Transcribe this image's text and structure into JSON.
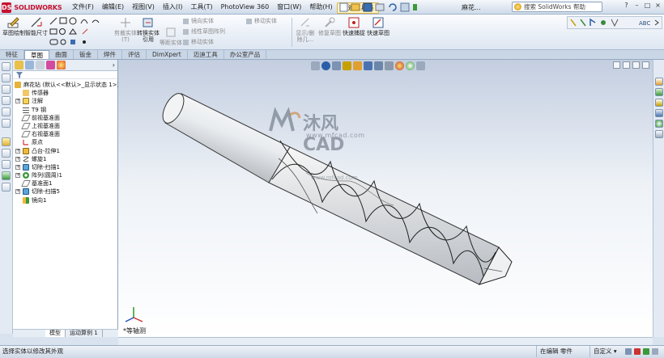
{
  "app": {
    "brand": "SOLIDWORKS",
    "logo_mark": "DS"
  },
  "menu": [
    "文件(F)",
    "编辑(E)",
    "视图(V)",
    "插入(I)",
    "工具(T)",
    "PhotoView 360",
    "窗口(W)",
    "帮助(H)",
    "迈迪工具集"
  ],
  "quickbar": {
    "doc_name": "麻花..."
  },
  "search": {
    "placeholder": "搜索 SolidWorks 帮助"
  },
  "window_buttons": [
    "?",
    "–",
    "□",
    "×"
  ],
  "commands": {
    "sketch": "草图绘制",
    "smart_dim": "智能尺寸",
    "trim": "剪裁实体(T)",
    "convert": "转换实体引用",
    "offset": "等距实体",
    "mirror": "镜向实体",
    "linear_pattern": "线性草图阵列",
    "move": "移动实体",
    "display_delete": "显示/删除几...",
    "repair": "修复草图",
    "rapid_sketch": "快速捕捉",
    "quick_sketch": "快速草图"
  },
  "tabs": [
    "特征",
    "草图",
    "曲面",
    "钣金",
    "焊件",
    "评估",
    "DimXpert",
    "迈迪工具",
    "办公室产品"
  ],
  "active_tab": "草图",
  "tree": {
    "root": "麻花钻  (默认<<默认>_显示状态 1>)",
    "items": [
      {
        "label": "传感器",
        "icon": "sensor-icon",
        "exp": ""
      },
      {
        "label": "注解",
        "icon": "annotation-icon",
        "exp": "+"
      },
      {
        "label": "T9  钢",
        "icon": "material-icon",
        "exp": ""
      },
      {
        "label": "前视基准面",
        "icon": "plane-icon",
        "exp": ""
      },
      {
        "label": "上视基准面",
        "icon": "plane-icon",
        "exp": ""
      },
      {
        "label": "右视基准面",
        "icon": "plane-icon",
        "exp": ""
      },
      {
        "label": "原点",
        "icon": "origin-icon",
        "exp": ""
      },
      {
        "label": "凸台-拉伸1",
        "icon": "extrude-icon",
        "exp": "+"
      },
      {
        "label": "螺旋1",
        "icon": "helix-icon",
        "exp": "+"
      },
      {
        "label": "切除-扫描1",
        "icon": "sweep-cut-icon",
        "exp": "+"
      },
      {
        "label": "阵列(圆周)1",
        "icon": "pattern-icon",
        "exp": "+"
      },
      {
        "label": "基准面1",
        "icon": "plane-icon",
        "exp": ""
      },
      {
        "label": "切除-扫描5",
        "icon": "sweep-cut-icon",
        "exp": "+"
      },
      {
        "label": "镜向1",
        "icon": "mirror-icon",
        "exp": ""
      }
    ]
  },
  "bottom_tabs": [
    "模型",
    "运动算例 1"
  ],
  "watermark": {
    "title": "沐风CAD",
    "url": "www.mfcad.com",
    "url2": "www.mfcad.com"
  },
  "view_label": "*等轴测",
  "status": {
    "left": "选择实体以修改其外观",
    "mode": "在编辑 零件",
    "units": "自定义 ▾"
  },
  "colors": {
    "accent": "#c8102e",
    "tab_bg": "#c9d6e6",
    "graphics_top": "#c3cee0"
  }
}
